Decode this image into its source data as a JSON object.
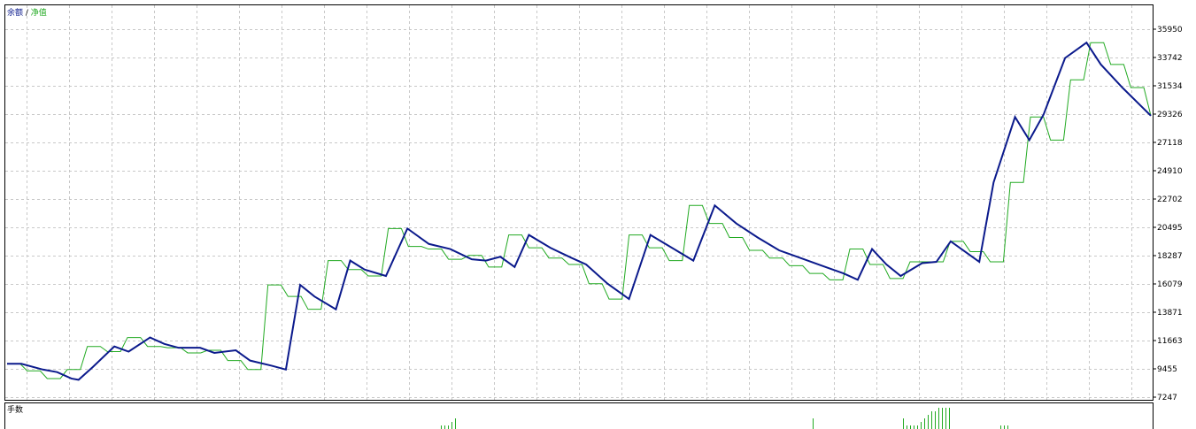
{
  "legend": {
    "balance": "余额",
    "separator": " / ",
    "equity": "净值"
  },
  "volume_label": "手数",
  "colors": {
    "balance": "#0b1a8c",
    "equity": "#22aa22",
    "grid": "#c8c8c8",
    "volume": "#22aa22",
    "frame": "#000000"
  },
  "chart_data": {
    "type": "line",
    "ylim": [
      7247,
      37000
    ],
    "grid": true,
    "y_ticks": [
      7247,
      9455,
      11663,
      13871,
      16079,
      18287,
      20495,
      22702,
      24910,
      27118,
      29326,
      31534,
      33742,
      35950
    ],
    "x": [
      0,
      1,
      2,
      3,
      4,
      5,
      6,
      7,
      8,
      9,
      10,
      11,
      12,
      13,
      14,
      15,
      16,
      17,
      18,
      19,
      20,
      21,
      22,
      23,
      24,
      25,
      26,
      27,
      28,
      29,
      30,
      31,
      32,
      33,
      34,
      35,
      36,
      37,
      38,
      39,
      40,
      41,
      42,
      43,
      44,
      45,
      46,
      47,
      48,
      49,
      50,
      51,
      52,
      53,
      54,
      55,
      56,
      57,
      58,
      59,
      60,
      61,
      62,
      63,
      64,
      65,
      66,
      67,
      68,
      69,
      70,
      71,
      72,
      73,
      74,
      75,
      76,
      77,
      78,
      79,
      80
    ],
    "series": [
      {
        "name": "余额",
        "values": [
          9850,
          9850,
          9400,
          9200,
          8700,
          8600,
          9600,
          11200,
          10800,
          11900,
          11400,
          11100,
          11100,
          10700,
          10900,
          10100,
          9700,
          9400,
          16000,
          15100,
          14100,
          17900,
          17200,
          16700,
          20400,
          19200,
          18800,
          18000,
          17900,
          18200,
          17400,
          19900,
          18900,
          18100,
          17600,
          16100,
          14900,
          19900,
          18900,
          17900,
          22200,
          20800,
          19700,
          18700,
          18100,
          17500,
          16900,
          16400,
          18800,
          17600,
          16700,
          17700,
          17800,
          19400,
          18600,
          17800,
          24000,
          29100,
          27300,
          29300,
          33700,
          34900,
          33200,
          31400,
          29200
        ],
        "x": [
          0,
          2,
          5,
          7,
          9,
          10,
          12,
          15,
          17,
          20,
          22,
          24,
          27,
          29,
          32,
          34,
          37,
          39,
          41,
          43,
          46,
          48,
          50,
          53,
          56,
          59,
          62,
          65,
          67,
          69,
          71,
          73,
          76,
          79,
          81,
          84,
          87,
          90,
          93,
          96,
          99,
          102,
          105,
          108,
          111,
          114,
          117,
          119,
          121,
          123,
          125,
          128,
          130,
          132,
          134,
          136,
          138,
          141,
          143,
          145,
          148,
          151,
          153,
          156,
          160
        ]
      },
      {
        "name": "净值",
        "values": [
          9850,
          9300,
          8700,
          9400,
          11200,
          10800,
          11900,
          11200,
          11100,
          10700,
          10900,
          10100,
          9400,
          16000,
          15100,
          14100,
          17900,
          17200,
          16700,
          20400,
          19000,
          18800,
          18000,
          18300,
          17400,
          19900,
          18900,
          18100,
          17600,
          16100,
          14900,
          19900,
          18900,
          17900,
          22200,
          20800,
          19700,
          18700,
          18100,
          17500,
          16900,
          16400,
          18800,
          17600,
          16500,
          17800,
          17800,
          19400,
          18600,
          17800,
          24000,
          29100,
          27300,
          32000,
          34900,
          33200,
          31400,
          29200
        ]
      }
    ]
  },
  "volume_data": {
    "bars": [
      1,
      1,
      1,
      2,
      3,
      3,
      3,
      1,
      1,
      1,
      1,
      2,
      3,
      4,
      5,
      5,
      6,
      6,
      6,
      6,
      1,
      1,
      1
    ]
  }
}
